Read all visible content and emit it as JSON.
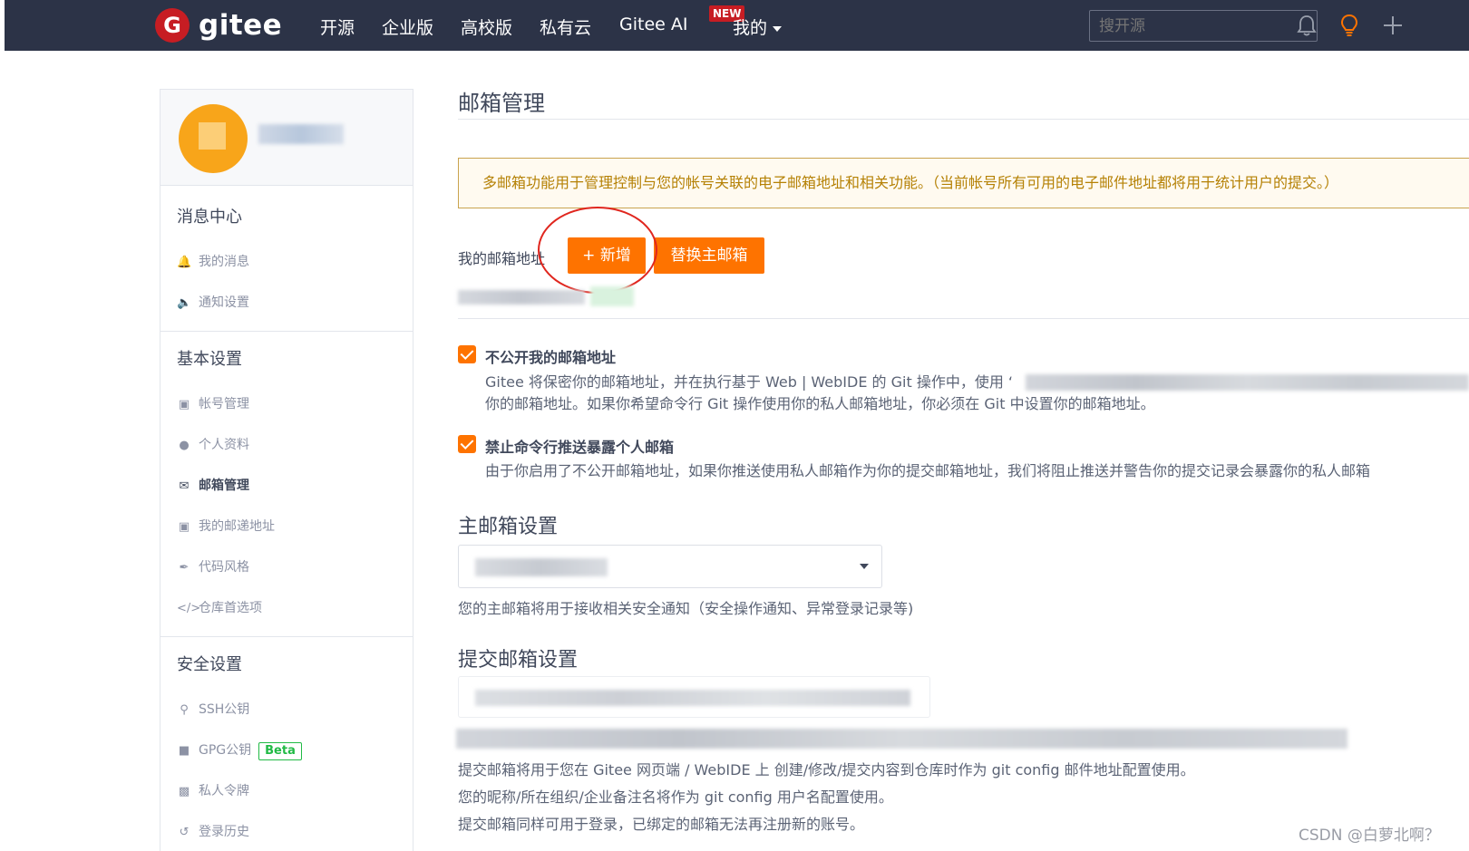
{
  "header": {
    "logo_letter": "G",
    "logo_text": "gitee",
    "nav": [
      "开源",
      "企业版",
      "高校版",
      "私有云",
      "Gitee AI",
      "我的"
    ],
    "new_badge": "NEW",
    "search_placeholder": "搜开源"
  },
  "sidebar": {
    "groups": [
      {
        "title": "消息中心",
        "items": [
          {
            "label": "我的消息",
            "icon": "bell-icon"
          },
          {
            "label": "通知设置",
            "icon": "speaker-icon"
          }
        ]
      },
      {
        "title": "基本设置",
        "items": [
          {
            "label": "帐号管理",
            "icon": "id-card-icon"
          },
          {
            "label": "个人资料",
            "icon": "user-icon"
          },
          {
            "label": "邮箱管理",
            "icon": "envelope-icon",
            "active": true
          },
          {
            "label": "我的邮递地址",
            "icon": "address-card-icon"
          },
          {
            "label": "代码风格",
            "icon": "brush-icon"
          },
          {
            "label": "仓库首选项",
            "icon": "code-icon"
          }
        ]
      },
      {
        "title": "安全设置",
        "items": [
          {
            "label": "SSH公钥",
            "icon": "key-icon"
          },
          {
            "label": "GPG公钥",
            "icon": "lock-icon",
            "badge": "Beta"
          },
          {
            "label": "私人令牌",
            "icon": "token-icon"
          },
          {
            "label": "登录历史",
            "icon": "history-icon"
          }
        ]
      }
    ]
  },
  "main": {
    "title": "邮箱管理",
    "notice": "多邮箱功能用于管理控制与您的帐号关联的电子邮箱地址和相关功能。（当前帐号所有可用的电子邮件地址都将用于统计用户的提交。）",
    "my_email_label": "我的邮箱地址",
    "add_button": "+ 新增",
    "replace_button": "替换主邮箱",
    "option1": {
      "title": "不公开我的邮箱地址",
      "desc_line1": "Gitee 将保密你的邮箱地址，并在执行基于 Web | WebIDE 的 Git 操作中，使用 ‘",
      "desc_line2": "你的邮箱地址。如果你希望命令行 Git 操作使用你的私人邮箱地址，你必须在 Git 中设置你的邮箱地址。",
      "checked": true
    },
    "option2": {
      "title": "禁止命令行推送暴露个人邮箱",
      "desc": "由于你启用了不公开邮箱地址，如果你推送使用私人邮箱作为你的提交邮箱地址，我们将阻止推送并警告你的提交记录会暴露你的私人邮箱",
      "checked": true
    },
    "primary_section": {
      "title": "主邮箱设置",
      "help": "您的主邮箱将用于接收相关安全通知（安全操作通知、异常登录记录等)"
    },
    "commit_section": {
      "title": "提交邮箱设置",
      "help_lines": [
        "提交邮箱将用于您在 Gitee 网页端 / WebIDE 上 创建/修改/提交内容到仓库时作为 git config 邮件地址配置使用。",
        "您的昵称/所在组织/企业备注名将作为 git config 用户名配置使用。",
        "提交邮箱同样可用于登录，已绑定的邮箱无法再注册新的账号。"
      ]
    }
  },
  "watermark": "CSDN @白萝北啊？",
  "colors": {
    "nav_bg": "#2c3347",
    "accent": "#fe7300",
    "brand_red": "#c71d23",
    "notice_text": "#b58105"
  }
}
